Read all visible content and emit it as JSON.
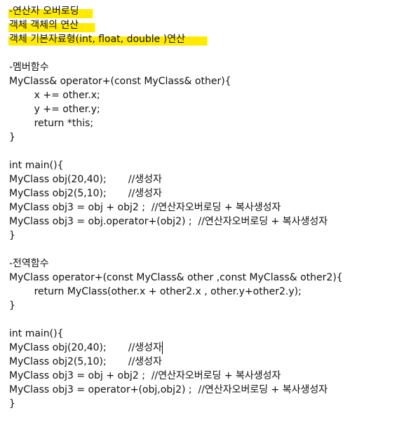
{
  "notes": {
    "title_lines": [
      "-연산자 오버로딩",
      "객체 객체의 연산",
      "객체 기본자료형(int, float, double )연산"
    ],
    "member_section": {
      "heading": "-멤버함수",
      "code": [
        "MyClass& operator+(const MyClass& other){",
        "        x += other.x;",
        "        y += other.y;",
        "        return *this;",
        "}",
        "",
        "int main(){",
        "MyClass obj(20,40);       //생성자",
        "MyClass obj2(5,10);       //생성자",
        "MyClass obj3 = obj + obj2 ;  //연산자오버로딩 + 복사생성자",
        "MyClass obj3 = obj.operator+(obj2) ;  //연산자오버로딩 + 복사생성자",
        "}"
      ]
    },
    "global_section": {
      "heading": "-전역함수",
      "code": [
        "MyClass operator+(const MyClass& other ,const MyClass& other2){",
        "        return MyClass(other.x + other2.x , other.y+other2.y);",
        "}",
        "",
        "int main(){",
        "MyClass obj(20,40);       //생성자",
        "MyClass obj2(5,10);       //생성자",
        "MyClass obj3 = obj + obj2 ;  //연산자오버로딩 + 복사생성자",
        "MyClass obj3 = operator+(obj,obj2) ;  //연산자오버로딩 + 복사생성자",
        "}"
      ]
    }
  },
  "colors": {
    "highlight": "#ffea00",
    "text": "#111111",
    "background": "#ffffff"
  }
}
